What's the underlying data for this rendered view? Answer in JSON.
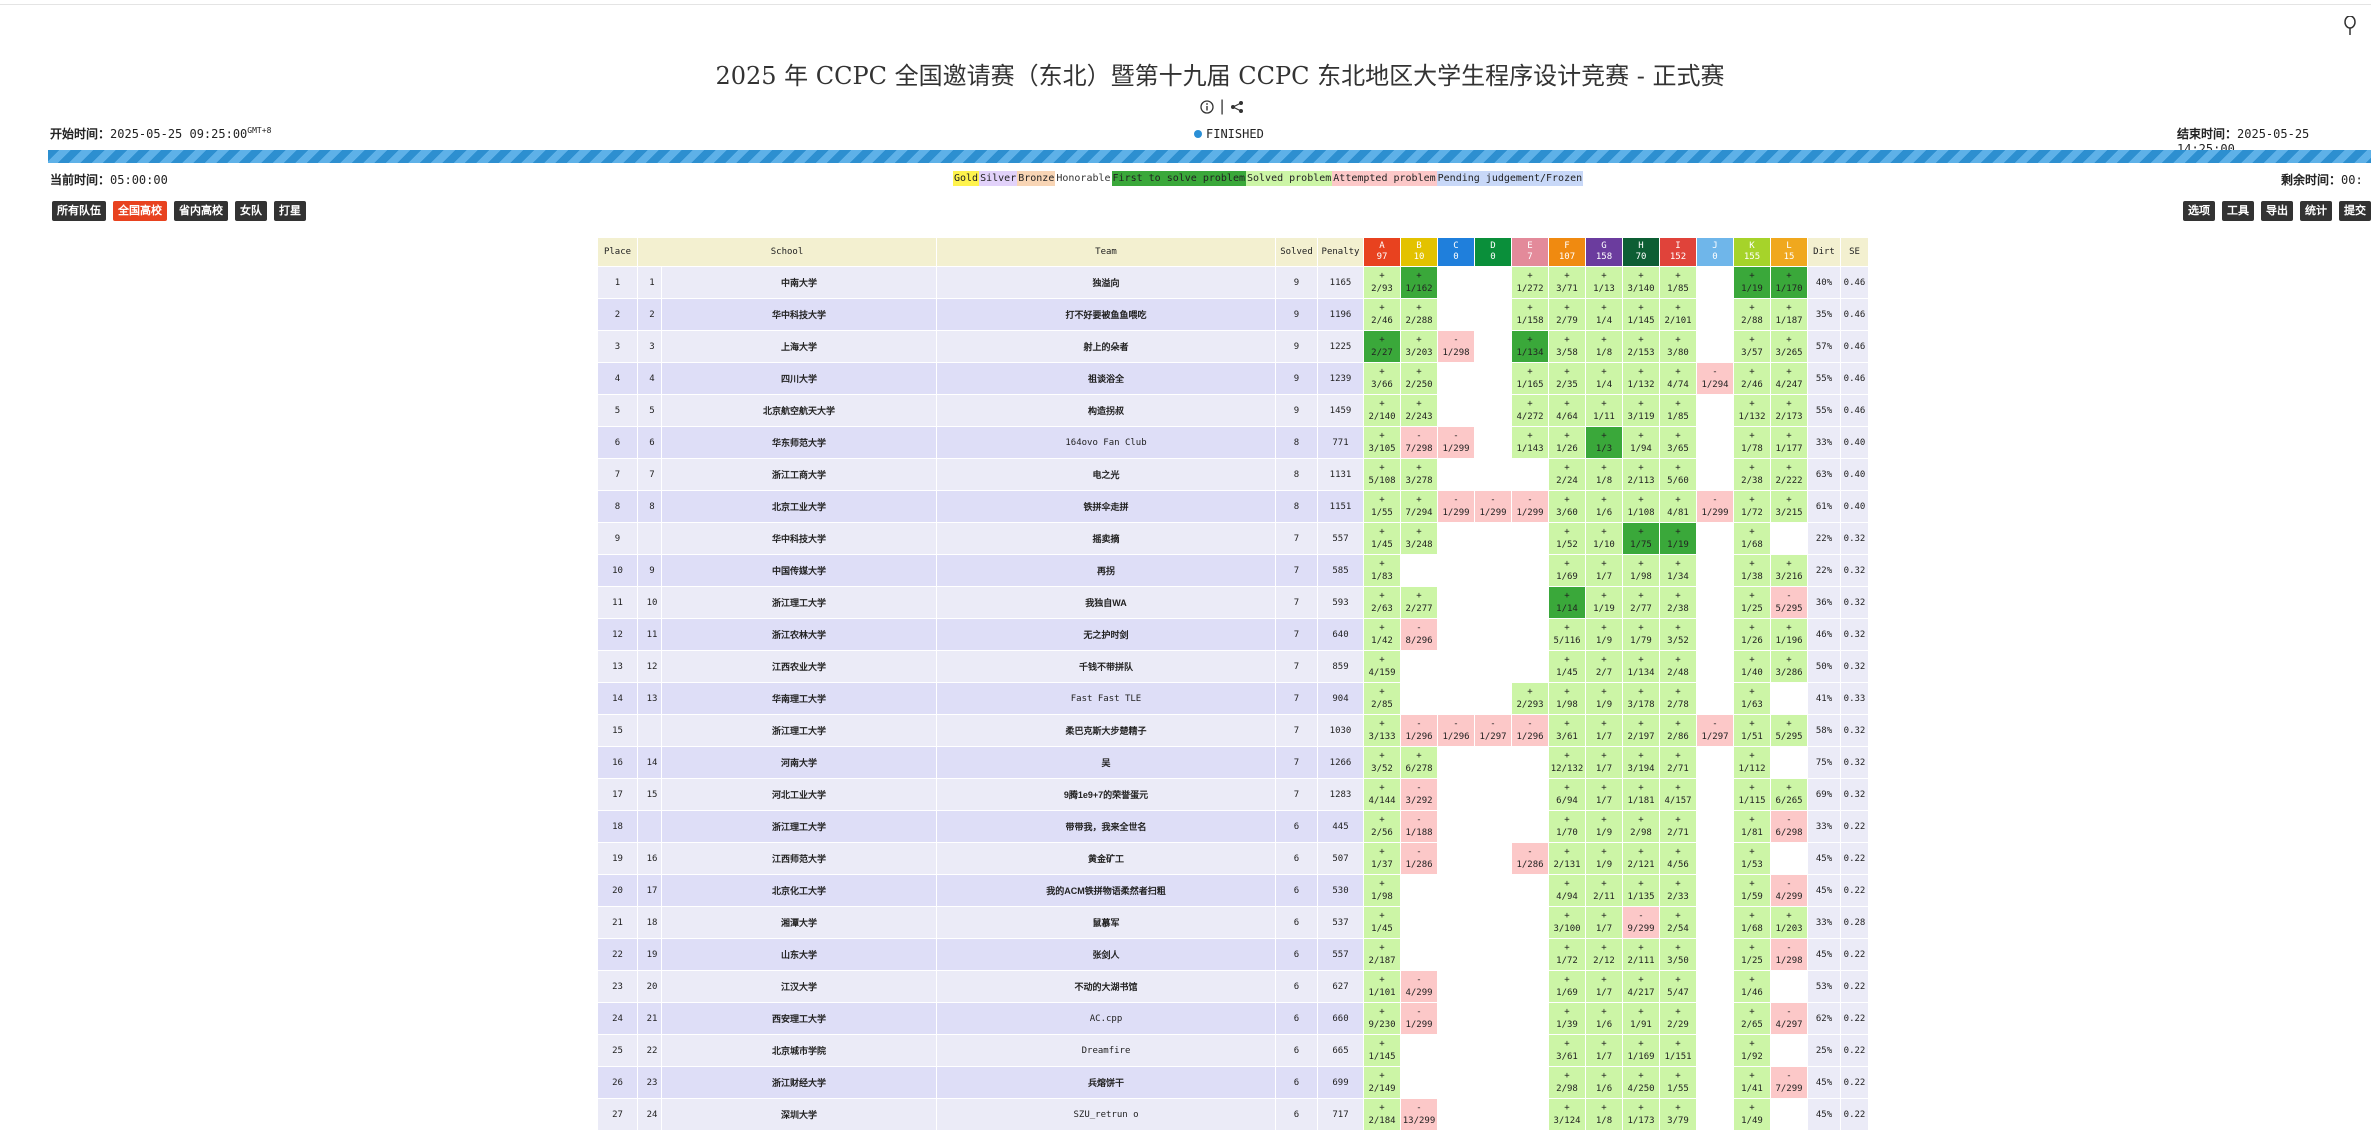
{
  "header": {
    "title": "2025 年 CCPC 全国邀请赛（东北）暨第十九届 CCPC 东北地区大学生程序设计竞赛 - 正式赛",
    "start_label": "开始时间：",
    "start_value": "2025-05-25 09:25:00",
    "tz": "GMT+8",
    "end_label": "结束时间：",
    "end_value": "2025-05-25 14:25:00",
    "current_label": "当前时间：",
    "current_value": "05:00:00",
    "remaining_label": "剩余时间：",
    "remaining_value": "00:",
    "status": "FINISHED"
  },
  "progress": {
    "fraction": 1.0
  },
  "legend": [
    {
      "label": "Gold",
      "bg": "#fff34d"
    },
    {
      "label": "Silver",
      "bg": "#e2d2fa"
    },
    {
      "label": "Bronze",
      "bg": "#f8d5b5"
    },
    {
      "label": "Honorable",
      "bg": "#ffffff"
    },
    {
      "label": "First to solve problem",
      "bg": "#3aa83a"
    },
    {
      "label": "Solved problem",
      "bg": "#ccf5a6"
    },
    {
      "label": "Attempted problem",
      "bg": "#fcc8c8"
    },
    {
      "label": "Pending judgement/Frozen",
      "bg": "#c8d8f8"
    }
  ],
  "filters": [
    "所有队伍",
    "全国高校",
    "省内高校",
    "女队",
    "打星"
  ],
  "filters_active": 1,
  "tools": [
    "选项",
    "工具",
    "导出",
    "统计",
    "提交"
  ],
  "columns": {
    "place": "Place",
    "school": "School",
    "team": "Team",
    "solved": "Solved",
    "penalty": "Penalty",
    "dirt": "Dirt",
    "se": "SE"
  },
  "problems": [
    {
      "id": "A",
      "count": "97",
      "color": "#e8421f"
    },
    {
      "id": "B",
      "count": "10",
      "color": "#e3c200"
    },
    {
      "id": "C",
      "count": "0",
      "color": "#1f7fdc"
    },
    {
      "id": "D",
      "count": "0",
      "color": "#0a8f3a"
    },
    {
      "id": "E",
      "count": "7",
      "color": "#e38a9a"
    },
    {
      "id": "F",
      "count": "107",
      "color": "#f08a10"
    },
    {
      "id": "G",
      "count": "158",
      "color": "#6b3c9e"
    },
    {
      "id": "H",
      "count": "70",
      "color": "#0d5e34"
    },
    {
      "id": "I",
      "count": "152",
      "color": "#e0433a"
    },
    {
      "id": "J",
      "count": "0",
      "color": "#6fb6ea"
    },
    {
      "id": "K",
      "count": "155",
      "color": "#a6d32a"
    },
    {
      "id": "L",
      "count": "15",
      "color": "#f0a81e"
    }
  ],
  "rows": [
    {
      "place": "1",
      "rank": "1",
      "school": "中南大学",
      "team": "独溢向",
      "solved": "9",
      "penalty": "1165",
      "dirt": "40%",
      "se": "0.46",
      "cells": [
        "+|2/93",
        "+|1/162|fb",
        "",
        "",
        "+|1/272",
        "+|3/71",
        "+|1/13",
        "+|3/140",
        "+|1/85",
        "",
        "+|1/19|fb",
        "+|1/170|fb"
      ]
    },
    {
      "place": "2",
      "rank": "2",
      "school": "华中科技大学",
      "team": "打不好要被鱼鱼喂吃",
      "solved": "9",
      "penalty": "1196",
      "dirt": "35%",
      "se": "0.46",
      "cells": [
        "+|2/46",
        "+|2/288",
        "",
        "",
        "+|1/158",
        "+|2/79",
        "+|1/4",
        "+|1/145",
        "+|2/101",
        "",
        "+|2/88",
        "+|1/187"
      ]
    },
    {
      "place": "3",
      "rank": "3",
      "school": "上海大学",
      "team": "射上的朵者",
      "solved": "9",
      "penalty": "1225",
      "dirt": "57%",
      "se": "0.46",
      "cells": [
        "+|2/27|fb",
        "+|3/203",
        "-|1/298|fail",
        "",
        "+|1/134|fb",
        "+|3/58",
        "+|1/8",
        "+|2/153",
        "+|3/80",
        "",
        "+|3/57",
        "+|3/265"
      ]
    },
    {
      "place": "4",
      "rank": "4",
      "school": "四川大学",
      "team": "祖谈浴全",
      "solved": "9",
      "penalty": "1239",
      "dirt": "55%",
      "se": "0.46",
      "cells": [
        "+|3/66",
        "+|2/250",
        "",
        "",
        "+|1/165",
        "+|2/35",
        "+|1/4",
        "+|1/132",
        "+|4/74",
        "-|1/294|fail",
        "+|2/46",
        "+|4/247"
      ]
    },
    {
      "place": "5",
      "rank": "5",
      "school": "北京航空航天大学",
      "team": "构造拐叔",
      "solved": "9",
      "penalty": "1459",
      "dirt": "55%",
      "se": "0.46",
      "cells": [
        "+|2/140",
        "+|2/243",
        "",
        "",
        "+|4/272",
        "+|4/64",
        "+|1/11",
        "+|3/119",
        "+|1/85",
        "",
        "+|1/132",
        "+|2/173"
      ]
    },
    {
      "place": "6",
      "rank": "6",
      "school": "华东师范大学",
      "team": "164ovo Fan Club",
      "mono": true,
      "solved": "8",
      "penalty": "771",
      "dirt": "33%",
      "se": "0.40",
      "cells": [
        "+|3/105",
        "-|7/298|fail",
        "-|1/299|fail",
        "",
        "+|1/143",
        "+|1/26",
        "+|1/3|fb",
        "+|1/94",
        "+|3/65",
        "",
        "+|1/78",
        "+|1/177"
      ]
    },
    {
      "place": "7",
      "rank": "7",
      "school": "浙江工商大学",
      "team": "电之光",
      "solved": "8",
      "penalty": "1131",
      "dirt": "63%",
      "se": "0.40",
      "cells": [
        "+|5/108",
        "+|3/278",
        "",
        "",
        "",
        "+|2/24",
        "+|1/8",
        "+|2/113",
        "+|5/60",
        "",
        "+|2/38",
        "+|2/222"
      ]
    },
    {
      "place": "8",
      "rank": "8",
      "school": "北京工业大学",
      "team": "铁拼伞走拼",
      "solved": "8",
      "penalty": "1151",
      "dirt": "61%",
      "se": "0.40",
      "cells": [
        "+|1/55",
        "+|7/294",
        "-|1/299|fail",
        "-|1/299|fail",
        "-|1/299|fail",
        "+|3/60",
        "+|1/6",
        "+|1/108",
        "+|4/81",
        "-|1/299|fail",
        "+|1/72",
        "+|3/215"
      ]
    },
    {
      "place": "9",
      "rank": "",
      "school": "华中科技大学",
      "team": "摇卖摘",
      "solved": "7",
      "penalty": "557",
      "dirt": "22%",
      "se": "0.32",
      "cells": [
        "+|1/45",
        "+|3/248",
        "",
        "",
        "",
        "+|1/52",
        "+|1/10",
        "+|1/75|fb",
        "+|1/19|fb",
        "",
        "+|1/68",
        ""
      ]
    },
    {
      "place": "10",
      "rank": "9",
      "school": "中国传媒大学",
      "team": "再拐",
      "solved": "7",
      "penalty": "585",
      "dirt": "22%",
      "se": "0.32",
      "cells": [
        "+|1/83",
        "",
        "",
        "",
        "",
        "+|1/69",
        "+|1/7",
        "+|1/98",
        "+|1/34",
        "",
        "+|1/38",
        "+|3/216"
      ]
    },
    {
      "place": "11",
      "rank": "10",
      "school": "浙江理工大学",
      "team": "我独自WA",
      "solved": "7",
      "penalty": "593",
      "dirt": "36%",
      "se": "0.32",
      "cells": [
        "+|2/63",
        "+|2/277",
        "",
        "",
        "",
        "+|1/14|fb",
        "+|1/19",
        "+|2/77",
        "+|2/38",
        "",
        "+|1/25",
        "-|5/295|fail"
      ]
    },
    {
      "place": "12",
      "rank": "11",
      "school": "浙江农林大学",
      "team": "无之护时剑",
      "solved": "7",
      "penalty": "640",
      "dirt": "46%",
      "se": "0.32",
      "cells": [
        "+|1/42",
        "-|8/296|fail",
        "",
        "",
        "",
        "+|5/116",
        "+|1/9",
        "+|1/79",
        "+|3/52",
        "",
        "+|1/26",
        "+|1/196"
      ]
    },
    {
      "place": "13",
      "rank": "12",
      "school": "江西农业大学",
      "team": "千钱不带拼队",
      "solved": "7",
      "penalty": "859",
      "dirt": "50%",
      "se": "0.32",
      "cells": [
        "+|4/159",
        "",
        "",
        "",
        "",
        "+|1/45",
        "+|2/7",
        "+|1/134",
        "+|2/48",
        "",
        "+|1/40",
        "+|3/286"
      ]
    },
    {
      "place": "14",
      "rank": "13",
      "school": "华南理工大学",
      "team": "Fast Fast TLE",
      "mono": true,
      "solved": "7",
      "penalty": "904",
      "dirt": "41%",
      "se": "0.33",
      "cells": [
        "+|2/85",
        "",
        "",
        "",
        "+|2/293",
        "+|1/98",
        "+|1/9",
        "+|3/178",
        "+|2/78",
        "",
        "+|1/63",
        ""
      ]
    },
    {
      "place": "15",
      "rank": "",
      "school": "浙江理工大学",
      "team": "柔巴克斯大步楚精子",
      "solved": "7",
      "penalty": "1030",
      "dirt": "58%",
      "se": "0.32",
      "cells": [
        "+|3/133",
        "-|1/296|fail",
        "-|1/296|fail",
        "-|1/297|fail",
        "-|1/296|fail",
        "+|3/61",
        "+|1/7",
        "+|2/197",
        "+|2/86",
        "-|1/297|fail",
        "+|1/51",
        "+|5/295"
      ]
    },
    {
      "place": "16",
      "rank": "14",
      "school": "河南大学",
      "team": "吴",
      "solved": "7",
      "penalty": "1266",
      "dirt": "75%",
      "se": "0.32",
      "cells": [
        "+|3/52",
        "+|6/278",
        "",
        "",
        "",
        "+|12/132",
        "+|1/7",
        "+|3/194",
        "+|2/71",
        "",
        "+|1/112",
        ""
      ]
    },
    {
      "place": "17",
      "rank": "15",
      "school": "河北工业大学",
      "team": "9腾1e9+7的荣誉蛋元",
      "solved": "7",
      "penalty": "1283",
      "dirt": "69%",
      "se": "0.32",
      "cells": [
        "+|4/144",
        "-|3/292|fail",
        "",
        "",
        "",
        "+|6/94",
        "+|1/7",
        "+|1/181",
        "+|4/157",
        "",
        "+|1/115",
        "+|6/265"
      ]
    },
    {
      "place": "18",
      "rank": "",
      "school": "浙江理工大学",
      "team": "带带我，我来全世名",
      "solved": "6",
      "penalty": "445",
      "dirt": "33%",
      "se": "0.22",
      "cells": [
        "+|2/56",
        "-|1/188|fail",
        "",
        "",
        "",
        "+|1/70",
        "+|1/9",
        "+|2/98",
        "+|2/71",
        "",
        "+|1/81",
        "-|6/298|fail"
      ]
    },
    {
      "place": "19",
      "rank": "16",
      "school": "江西师范大学",
      "team": "黄金矿工",
      "solved": "6",
      "penalty": "507",
      "dirt": "45%",
      "se": "0.22",
      "cells": [
        "+|1/37",
        "-|1/286|fail",
        "",
        "",
        "-|1/286|fail",
        "+|2/131",
        "+|1/9",
        "+|2/121",
        "+|4/56",
        "",
        "+|1/53",
        ""
      ]
    },
    {
      "place": "20",
      "rank": "17",
      "school": "北京化工大学",
      "team": "我的ACM铁拼物语柔然者扫粗",
      "solved": "6",
      "penalty": "530",
      "dirt": "45%",
      "se": "0.22",
      "cells": [
        "+|1/98",
        "",
        "",
        "",
        "",
        "+|4/94",
        "+|2/11",
        "+|1/135",
        "+|2/33",
        "",
        "+|1/59",
        "-|4/299|fail"
      ]
    },
    {
      "place": "21",
      "rank": "18",
      "school": "湘潭大学",
      "team": "鼠慕军",
      "solved": "6",
      "penalty": "537",
      "dirt": "33%",
      "se": "0.28",
      "cells": [
        "+|1/45",
        "",
        "",
        "",
        "",
        "+|3/100",
        "+|1/7",
        "-|9/299|fail",
        "+|2/54",
        "",
        "+|1/68",
        "+|1/203"
      ]
    },
    {
      "place": "22",
      "rank": "19",
      "school": "山东大学",
      "team": "张剑人",
      "solved": "6",
      "penalty": "557",
      "dirt": "45%",
      "se": "0.22",
      "cells": [
        "+|2/187",
        "",
        "",
        "",
        "",
        "+|1/72",
        "+|2/12",
        "+|2/111",
        "+|3/50",
        "",
        "+|1/25",
        "-|1/298|fail"
      ]
    },
    {
      "place": "23",
      "rank": "20",
      "school": "江汉大学",
      "team": "不动的大湖书馆",
      "solved": "6",
      "penalty": "627",
      "dirt": "53%",
      "se": "0.22",
      "cells": [
        "+|1/101",
        "-|4/299|fail",
        "",
        "",
        "",
        "+|1/69",
        "+|1/7",
        "+|4/217",
        "+|5/47",
        "",
        "+|1/46",
        ""
      ]
    },
    {
      "place": "24",
      "rank": "21",
      "school": "西安理工大学",
      "team": "AC.cpp",
      "mono": true,
      "solved": "6",
      "penalty": "660",
      "dirt": "62%",
      "se": "0.22",
      "cells": [
        "+|9/230",
        "-|1/299|fail",
        "",
        "",
        "",
        "+|1/39",
        "+|1/6",
        "+|1/91",
        "+|2/29",
        "",
        "+|2/65",
        "-|4/297|fail"
      ]
    },
    {
      "place": "25",
      "rank": "22",
      "school": "北京城市学院",
      "team": "Dreamfire",
      "mono": true,
      "solved": "6",
      "penalty": "665",
      "dirt": "25%",
      "se": "0.22",
      "cells": [
        "+|1/145",
        "",
        "",
        "",
        "",
        "+|3/61",
        "+|1/7",
        "+|1/169",
        "+|1/151",
        "",
        "+|1/92",
        ""
      ]
    },
    {
      "place": "26",
      "rank": "23",
      "school": "浙江财经大学",
      "team": "兵熔饼干",
      "solved": "6",
      "penalty": "699",
      "dirt": "45%",
      "se": "0.22",
      "cells": [
        "+|2/149",
        "",
        "",
        "",
        "",
        "+|2/98",
        "+|1/6",
        "+|4/250",
        "+|1/55",
        "",
        "+|1/41",
        "-|7/299|fail"
      ]
    },
    {
      "place": "27",
      "rank": "24",
      "school": "深圳大学",
      "team": "SZU_retrun o",
      "mono": true,
      "solved": "6",
      "penalty": "717",
      "dirt": "45%",
      "se": "0.22",
      "cells": [
        "+|2/184",
        "-|13/299|fail",
        "",
        "",
        "",
        "+|3/124",
        "+|1/8",
        "+|1/173",
        "+|3/79",
        "",
        "+|1/49",
        ""
      ]
    }
  ]
}
